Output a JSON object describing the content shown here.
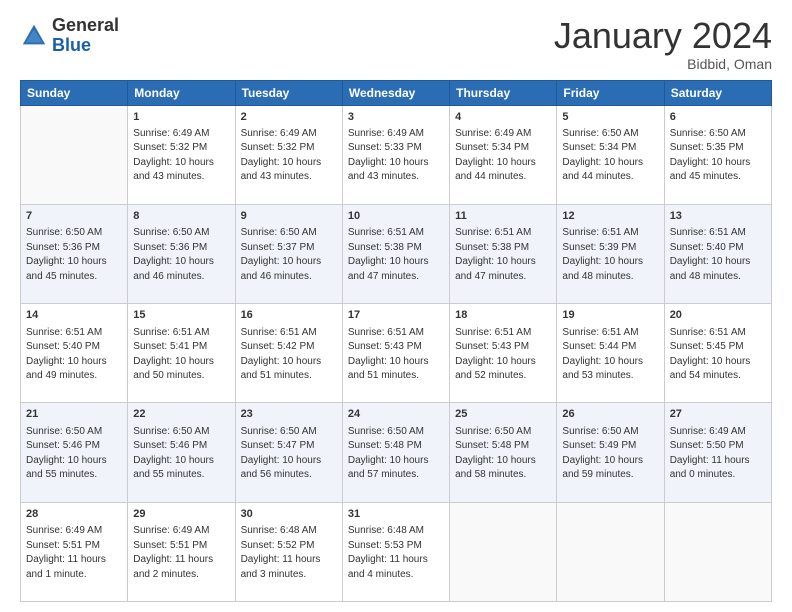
{
  "logo": {
    "line1": "General",
    "line2": "Blue"
  },
  "title": "January 2024",
  "subtitle": "Bidbid, Oman",
  "headers": [
    "Sunday",
    "Monday",
    "Tuesday",
    "Wednesday",
    "Thursday",
    "Friday",
    "Saturday"
  ],
  "weeks": [
    [
      {
        "day": "",
        "info": ""
      },
      {
        "day": "1",
        "info": "Sunrise: 6:49 AM\nSunset: 5:32 PM\nDaylight: 10 hours\nand 43 minutes."
      },
      {
        "day": "2",
        "info": "Sunrise: 6:49 AM\nSunset: 5:32 PM\nDaylight: 10 hours\nand 43 minutes."
      },
      {
        "day": "3",
        "info": "Sunrise: 6:49 AM\nSunset: 5:33 PM\nDaylight: 10 hours\nand 43 minutes."
      },
      {
        "day": "4",
        "info": "Sunrise: 6:49 AM\nSunset: 5:34 PM\nDaylight: 10 hours\nand 44 minutes."
      },
      {
        "day": "5",
        "info": "Sunrise: 6:50 AM\nSunset: 5:34 PM\nDaylight: 10 hours\nand 44 minutes."
      },
      {
        "day": "6",
        "info": "Sunrise: 6:50 AM\nSunset: 5:35 PM\nDaylight: 10 hours\nand 45 minutes."
      }
    ],
    [
      {
        "day": "7",
        "info": "Sunrise: 6:50 AM\nSunset: 5:36 PM\nDaylight: 10 hours\nand 45 minutes."
      },
      {
        "day": "8",
        "info": "Sunrise: 6:50 AM\nSunset: 5:36 PM\nDaylight: 10 hours\nand 46 minutes."
      },
      {
        "day": "9",
        "info": "Sunrise: 6:50 AM\nSunset: 5:37 PM\nDaylight: 10 hours\nand 46 minutes."
      },
      {
        "day": "10",
        "info": "Sunrise: 6:51 AM\nSunset: 5:38 PM\nDaylight: 10 hours\nand 47 minutes."
      },
      {
        "day": "11",
        "info": "Sunrise: 6:51 AM\nSunset: 5:38 PM\nDaylight: 10 hours\nand 47 minutes."
      },
      {
        "day": "12",
        "info": "Sunrise: 6:51 AM\nSunset: 5:39 PM\nDaylight: 10 hours\nand 48 minutes."
      },
      {
        "day": "13",
        "info": "Sunrise: 6:51 AM\nSunset: 5:40 PM\nDaylight: 10 hours\nand 48 minutes."
      }
    ],
    [
      {
        "day": "14",
        "info": "Sunrise: 6:51 AM\nSunset: 5:40 PM\nDaylight: 10 hours\nand 49 minutes."
      },
      {
        "day": "15",
        "info": "Sunrise: 6:51 AM\nSunset: 5:41 PM\nDaylight: 10 hours\nand 50 minutes."
      },
      {
        "day": "16",
        "info": "Sunrise: 6:51 AM\nSunset: 5:42 PM\nDaylight: 10 hours\nand 51 minutes."
      },
      {
        "day": "17",
        "info": "Sunrise: 6:51 AM\nSunset: 5:43 PM\nDaylight: 10 hours\nand 51 minutes."
      },
      {
        "day": "18",
        "info": "Sunrise: 6:51 AM\nSunset: 5:43 PM\nDaylight: 10 hours\nand 52 minutes."
      },
      {
        "day": "19",
        "info": "Sunrise: 6:51 AM\nSunset: 5:44 PM\nDaylight: 10 hours\nand 53 minutes."
      },
      {
        "day": "20",
        "info": "Sunrise: 6:51 AM\nSunset: 5:45 PM\nDaylight: 10 hours\nand 54 minutes."
      }
    ],
    [
      {
        "day": "21",
        "info": "Sunrise: 6:50 AM\nSunset: 5:46 PM\nDaylight: 10 hours\nand 55 minutes."
      },
      {
        "day": "22",
        "info": "Sunrise: 6:50 AM\nSunset: 5:46 PM\nDaylight: 10 hours\nand 55 minutes."
      },
      {
        "day": "23",
        "info": "Sunrise: 6:50 AM\nSunset: 5:47 PM\nDaylight: 10 hours\nand 56 minutes."
      },
      {
        "day": "24",
        "info": "Sunrise: 6:50 AM\nSunset: 5:48 PM\nDaylight: 10 hours\nand 57 minutes."
      },
      {
        "day": "25",
        "info": "Sunrise: 6:50 AM\nSunset: 5:48 PM\nDaylight: 10 hours\nand 58 minutes."
      },
      {
        "day": "26",
        "info": "Sunrise: 6:50 AM\nSunset: 5:49 PM\nDaylight: 10 hours\nand 59 minutes."
      },
      {
        "day": "27",
        "info": "Sunrise: 6:49 AM\nSunset: 5:50 PM\nDaylight: 11 hours\nand 0 minutes."
      }
    ],
    [
      {
        "day": "28",
        "info": "Sunrise: 6:49 AM\nSunset: 5:51 PM\nDaylight: 11 hours\nand 1 minute."
      },
      {
        "day": "29",
        "info": "Sunrise: 6:49 AM\nSunset: 5:51 PM\nDaylight: 11 hours\nand 2 minutes."
      },
      {
        "day": "30",
        "info": "Sunrise: 6:48 AM\nSunset: 5:52 PM\nDaylight: 11 hours\nand 3 minutes."
      },
      {
        "day": "31",
        "info": "Sunrise: 6:48 AM\nSunset: 5:53 PM\nDaylight: 11 hours\nand 4 minutes."
      },
      {
        "day": "",
        "info": ""
      },
      {
        "day": "",
        "info": ""
      },
      {
        "day": "",
        "info": ""
      }
    ]
  ]
}
